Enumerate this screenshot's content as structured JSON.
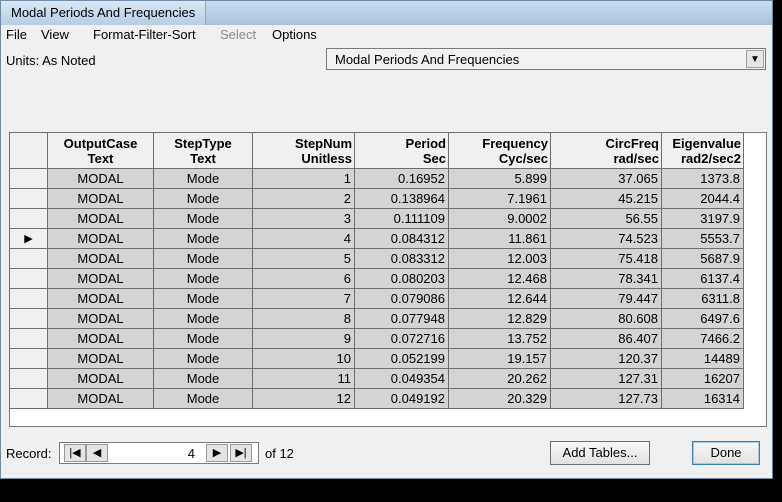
{
  "window": {
    "title": "Modal Periods And Frequencies"
  },
  "menu": [
    "File",
    "View",
    "Format-Filter-Sort",
    "Select",
    "Options"
  ],
  "units": {
    "label": "Units:",
    "value": "As Noted"
  },
  "table_selector": {
    "selected": "Modal Periods And Frequencies"
  },
  "grid": {
    "columns": [
      {
        "name": "OutputCase",
        "unit": "Text"
      },
      {
        "name": "StepType",
        "unit": "Text"
      },
      {
        "name": "StepNum",
        "unit": "Unitless"
      },
      {
        "name": "Period",
        "unit": "Sec"
      },
      {
        "name": "Frequency",
        "unit": "Cyc/sec"
      },
      {
        "name": "CircFreq",
        "unit": "rad/sec"
      },
      {
        "name": "Eigenvalue",
        "unit": "rad2/sec2"
      }
    ],
    "current_row_index": 3,
    "current_row_marker": "▶",
    "rows": [
      [
        "MODAL",
        "Mode",
        "1",
        "0.16952",
        "5.899",
        "37.065",
        "1373.8"
      ],
      [
        "MODAL",
        "Mode",
        "2",
        "0.138964",
        "7.1961",
        "45.215",
        "2044.4"
      ],
      [
        "MODAL",
        "Mode",
        "3",
        "0.111109",
        "9.0002",
        "56.55",
        "3197.9"
      ],
      [
        "MODAL",
        "Mode",
        "4",
        "0.084312",
        "11.861",
        "74.523",
        "5553.7"
      ],
      [
        "MODAL",
        "Mode",
        "5",
        "0.083312",
        "12.003",
        "75.418",
        "5687.9"
      ],
      [
        "MODAL",
        "Mode",
        "6",
        "0.080203",
        "12.468",
        "78.341",
        "6137.4"
      ],
      [
        "MODAL",
        "Mode",
        "7",
        "0.079086",
        "12.644",
        "79.447",
        "6311.8"
      ],
      [
        "MODAL",
        "Mode",
        "8",
        "0.077948",
        "12.829",
        "80.608",
        "6497.6"
      ],
      [
        "MODAL",
        "Mode",
        "9",
        "0.072716",
        "13.752",
        "86.407",
        "7466.2"
      ],
      [
        "MODAL",
        "Mode",
        "10",
        "0.052199",
        "19.157",
        "120.37",
        "14489"
      ],
      [
        "MODAL",
        "Mode",
        "11",
        "0.049354",
        "20.262",
        "127.31",
        "16207"
      ],
      [
        "MODAL",
        "Mode",
        "12",
        "0.049192",
        "20.329",
        "127.73",
        "16314"
      ]
    ]
  },
  "record_nav": {
    "label": "Record:",
    "current": "4",
    "of_text": "of 12"
  },
  "buttons": {
    "add_tables": "Add Tables...",
    "done": "Done"
  }
}
